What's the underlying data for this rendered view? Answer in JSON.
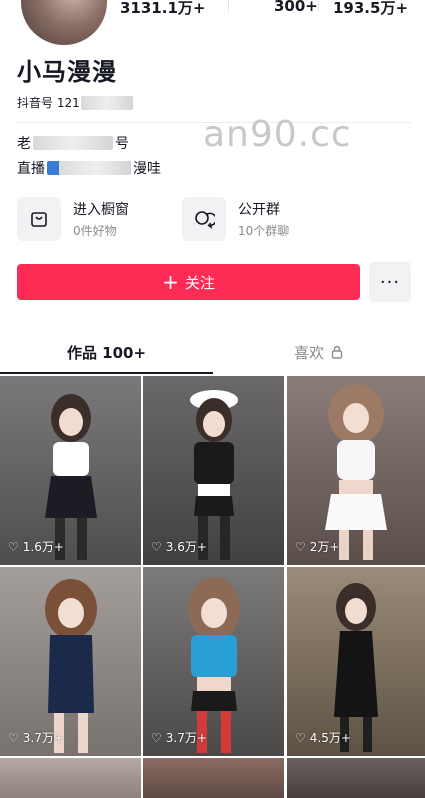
{
  "profile": {
    "stats": [
      "3131.1万+",
      "300+",
      "193.5万+"
    ],
    "name": "小马漫漫",
    "id_prefix": "抖音号 121",
    "bio_line1_prefix": "老",
    "bio_line1_suffix": "号",
    "bio_line2_prefix": "直播",
    "bio_line2_suffix": "漫哇",
    "watermark": "an90.cc"
  },
  "entries": [
    {
      "title": "进入橱窗",
      "sub": "0件好物",
      "icon": "bag-icon"
    },
    {
      "title": "公开群",
      "sub": "10个群聊",
      "icon": "chat-icon"
    }
  ],
  "actions": {
    "follow_label": "关注",
    "follow_plus": "+",
    "more_label": "···"
  },
  "tabs": {
    "works": "作品 100+",
    "likes": "喜欢"
  },
  "videos": [
    {
      "likes": "1.6万+",
      "bg": "#6b6a6a",
      "outfit": "#ffffff"
    },
    {
      "likes": "3.6万+",
      "bg": "#5a5858",
      "outfit": "#1a1a1a"
    },
    {
      "likes": "2万+",
      "bg": "#7a6e6b",
      "outfit": "#f5f5f5"
    },
    {
      "likes": "3.7万+",
      "bg": "#8f8a86",
      "outfit": "#1b2a4a"
    },
    {
      "likes": "3.7万+",
      "bg": "#6a6866",
      "outfit": "#2a9fd6"
    },
    {
      "likes": "4.5万+",
      "bg": "#8a7d6b",
      "outfit": "#1a1a1a"
    }
  ],
  "colors": {
    "accent": "#fe2c55",
    "text": "#161823",
    "muted": "#8a8b91"
  }
}
